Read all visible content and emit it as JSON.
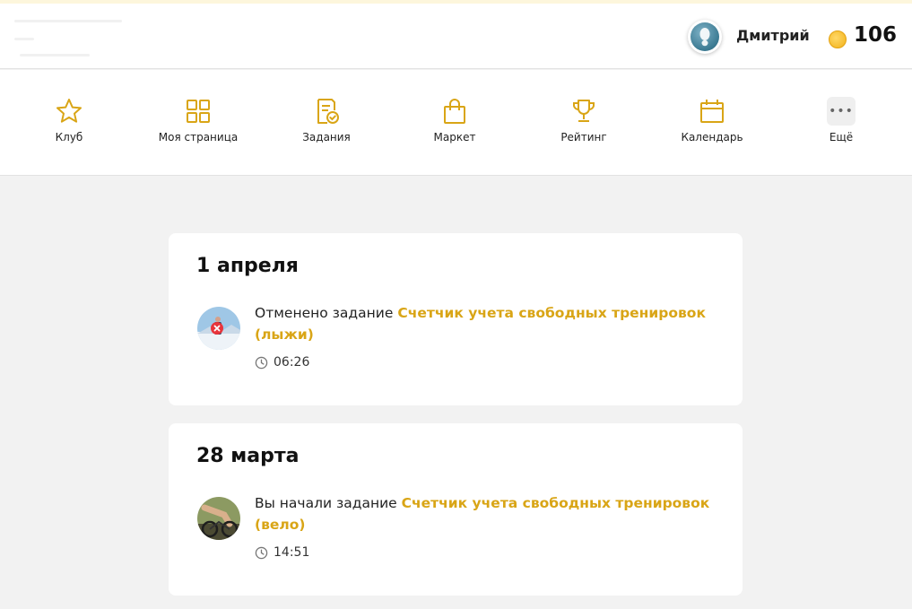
{
  "header": {
    "user_name": "Дмитрий",
    "coins": "106"
  },
  "nav": [
    {
      "label": "Клуб",
      "icon": "star-icon"
    },
    {
      "label": "Моя страница",
      "icon": "grid-icon"
    },
    {
      "label": "Задания",
      "icon": "task-check-icon"
    },
    {
      "label": "Маркет",
      "icon": "shopping-bag-icon"
    },
    {
      "label": "Рейтинг",
      "icon": "trophy-icon"
    },
    {
      "label": "Календарь",
      "icon": "calendar-icon"
    },
    {
      "label": "Ещё",
      "icon": "more-dots-icon"
    }
  ],
  "feed": [
    {
      "date": "1 апреля",
      "prefix": "Отменено задание ",
      "task_line1": "Счетчик учета свободных тренировок",
      "task_line2": "(лыжи)",
      "time": "06:26",
      "status": "cancelled"
    },
    {
      "date": "28 марта",
      "prefix": "Вы начали задание ",
      "task_line1": "Счетчик учета свободных тренировок",
      "task_line2": "(вело)",
      "time": "14:51",
      "status": "started"
    }
  ],
  "colors": {
    "accent": "#d9a516",
    "background": "#f2f2f2",
    "cancel_badge": "#e8343b"
  }
}
